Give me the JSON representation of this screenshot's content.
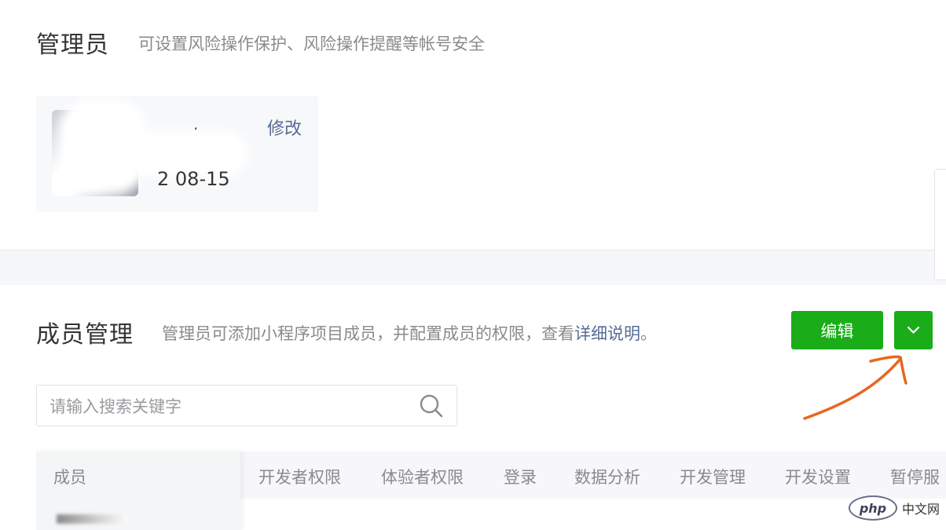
{
  "admin_section": {
    "title": "管理员",
    "description": "可设置风险操作保护、风险操作提醒等帐号安全",
    "account_date": "2 08-15",
    "modify_label": "修改"
  },
  "members_section": {
    "title": "成员管理",
    "description_prefix": "管理员可添加小程序项目成员，并配置成员的权限，查看",
    "detail_link": "详细说明",
    "description_suffix": "。",
    "edit_button": "编辑",
    "search": {
      "placeholder": "请输入搜索关键字",
      "value": ""
    },
    "table_columns": [
      "成员",
      "开发者权限",
      "体验者权限",
      "登录",
      "数据分析",
      "开发管理",
      "开发设置",
      "暂停服"
    ]
  },
  "watermark": {
    "brand": "php",
    "text": "中文网"
  },
  "colors": {
    "accent_green": "#1aad19",
    "link_blue": "#576b95",
    "annotation_arrow": "#e8671e"
  }
}
